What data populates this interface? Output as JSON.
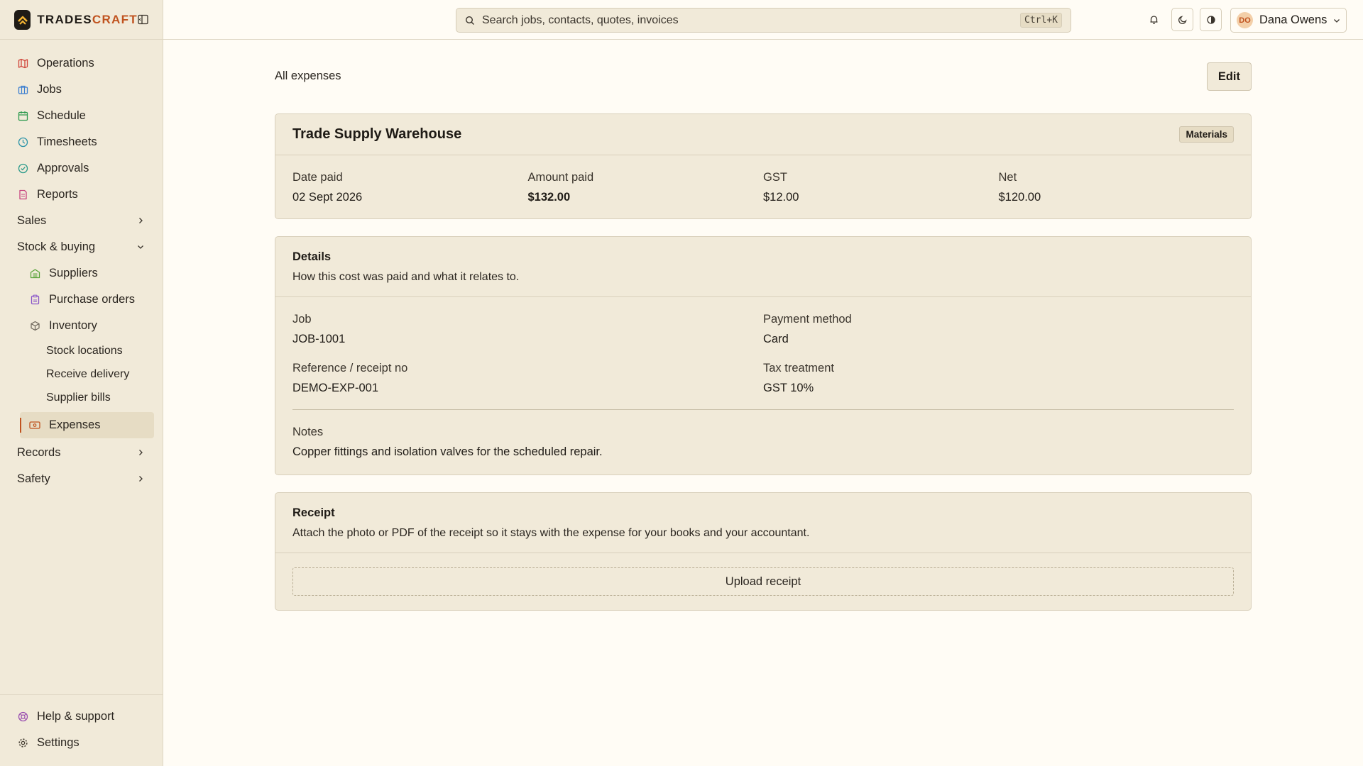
{
  "brand": {
    "name_main": "TRADES",
    "name_accent": "CRAFT"
  },
  "colors": {
    "accent": "#c0531f",
    "sidebar_bg": "#f1ead9",
    "page_bg": "#fffcf5",
    "card_bg": "#f1ead9"
  },
  "search": {
    "placeholder": "Search jobs, contacts, quotes, invoices",
    "shortcut": "Ctrl+K"
  },
  "user": {
    "initials": "DO",
    "name": "Dana Owens"
  },
  "sidebar": {
    "items": [
      {
        "label": "Operations",
        "icon": "map-icon"
      },
      {
        "label": "Jobs",
        "icon": "briefcase-icon"
      },
      {
        "label": "Schedule",
        "icon": "calendar-icon"
      },
      {
        "label": "Timesheets",
        "icon": "clock-icon"
      },
      {
        "label": "Approvals",
        "icon": "check-circle-icon"
      },
      {
        "label": "Reports",
        "icon": "document-icon"
      }
    ],
    "groups": {
      "sales": "Sales",
      "stock": "Stock & buying",
      "records": "Records",
      "safety": "Safety"
    },
    "stock_items": {
      "suppliers": "Suppliers",
      "purchase_orders": "Purchase orders",
      "inventory": "Inventory",
      "stock_locations": "Stock locations",
      "receive_delivery": "Receive delivery",
      "supplier_bills": "Supplier bills",
      "expenses": "Expenses"
    },
    "bottom": {
      "help": "Help & support",
      "settings": "Settings"
    }
  },
  "page": {
    "breadcrumb": "All expenses",
    "edit_label": "Edit"
  },
  "expense": {
    "supplier": "Trade Supply Warehouse",
    "category": "Materials",
    "summary": [
      {
        "label": "Date paid",
        "value": "02 Sept 2026"
      },
      {
        "label": "Amount paid",
        "value": "$132.00"
      },
      {
        "label": "GST",
        "value": "$12.00"
      },
      {
        "label": "Net",
        "value": "$120.00"
      }
    ]
  },
  "details": {
    "title": "Details",
    "description": "How this cost was paid and what it relates to.",
    "job_label": "Job",
    "job_value": "JOB-1001",
    "payment_label": "Payment method",
    "payment_value": "Card",
    "ref_label": "Reference / receipt no",
    "ref_value": "DEMO-EXP-001",
    "tax_label": "Tax treatment",
    "tax_value": "GST 10%",
    "notes_label": "Notes",
    "notes_value": "Copper fittings and isolation valves for the scheduled repair."
  },
  "receipt": {
    "title": "Receipt",
    "description": "Attach the photo or PDF of the receipt so it stays with the expense for your books and your accountant.",
    "upload_label": "Upload receipt"
  }
}
